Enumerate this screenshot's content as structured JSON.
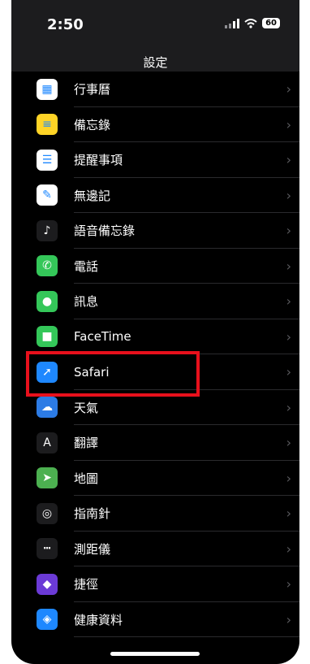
{
  "status": {
    "time": "2:50",
    "battery": "60"
  },
  "header": {
    "title": "設定"
  },
  "settings": [
    {
      "label": "行事曆",
      "icon": "calendar-icon",
      "color": "#ffffff"
    },
    {
      "label": "備忘錄",
      "icon": "notes-icon",
      "color": "#ffd426"
    },
    {
      "label": "提醒事項",
      "icon": "reminders-icon",
      "color": "#ffffff"
    },
    {
      "label": "無邊記",
      "icon": "freeform-icon",
      "color": "#ffffff"
    },
    {
      "label": "語音備忘錄",
      "icon": "voice-memos-icon",
      "color": "#1c1c1e"
    },
    {
      "label": "電話",
      "icon": "phone-icon",
      "color": "#34c759"
    },
    {
      "label": "訊息",
      "icon": "messages-icon",
      "color": "#34c759"
    },
    {
      "label": "FaceTime",
      "icon": "facetime-icon",
      "color": "#34c759"
    },
    {
      "label": "Safari",
      "icon": "safari-icon",
      "color": "#1e88ff"
    },
    {
      "label": "天氣",
      "icon": "weather-icon",
      "color": "#2c7be5"
    },
    {
      "label": "翻譯",
      "icon": "translate-icon",
      "color": "#1c1c1e"
    },
    {
      "label": "地圖",
      "icon": "maps-icon",
      "color": "#4cb050"
    },
    {
      "label": "指南針",
      "icon": "compass-icon",
      "color": "#1c1c1e"
    },
    {
      "label": "測距儀",
      "icon": "measure-icon",
      "color": "#1c1c1e"
    },
    {
      "label": "捷徑",
      "icon": "shortcuts-icon",
      "color": "#6b3ad6"
    },
    {
      "label": "健康資料",
      "icon": "health-icon",
      "color": "#1e88ff"
    }
  ]
}
